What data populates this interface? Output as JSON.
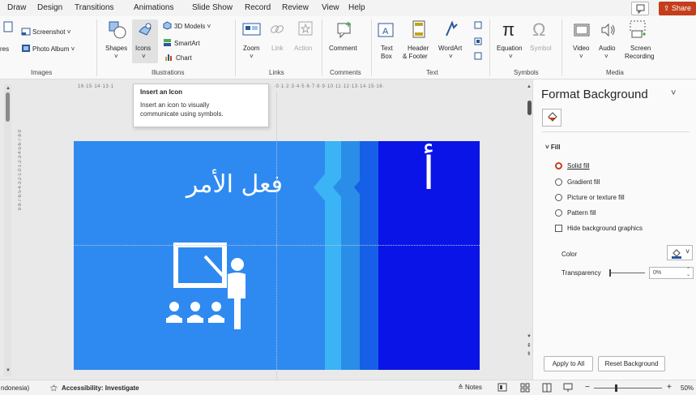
{
  "menu": {
    "tabs": [
      "Draw",
      "Design",
      "Transitions",
      "Animations",
      "Slide Show",
      "Record",
      "Review",
      "View",
      "Help"
    ],
    "share_label": "Share"
  },
  "ribbon": {
    "images": {
      "screenshot": "Screenshot ˅",
      "photo_album": "Photo Album ˅",
      "pictures_partial": "res",
      "group_label": "Images"
    },
    "illustrations": {
      "shapes": "Shapes",
      "icons": "Icons",
      "models_3d": "3D Models ˅",
      "smartart": "SmartArt",
      "chart": "Chart",
      "group_label": "Illustrations"
    },
    "links": {
      "zoom": "Zoom",
      "link": "Link",
      "action": "Action",
      "group_label": "Links"
    },
    "comments": {
      "comment": "Comment",
      "group_label": "Comments"
    },
    "text": {
      "text_box_1": "Text",
      "text_box_2": "Box",
      "header_footer_1": "Header",
      "header_footer_2": "& Footer",
      "wordart": "WordArt",
      "group_label": "Text"
    },
    "symbols": {
      "equation": "Equation",
      "symbol": "Symbol",
      "group_label": "Symbols"
    },
    "media": {
      "video": "Video",
      "audio": "Audio",
      "screen_rec_1": "Screen",
      "screen_rec_2": "Recording",
      "group_label": "Media"
    }
  },
  "tooltip": {
    "title": "Insert an Icon",
    "body_line1": "Insert an icon to visually",
    "body_line2": "communicate using symbols."
  },
  "ruler": {
    "horizontal": "16·15·14·13·1",
    "horizontal_right": "·0·1·2·3·4·5·6·7·8·9·10·11·12·13·14·15·16·",
    "vertical": "9·8·7·6·5·4·3·2·1·0·1·2·3·4·5·6·7·8·9"
  },
  "slide": {
    "title_text": "فعل الأمر",
    "letter": "أ",
    "colors": {
      "bg": "#2e8af0",
      "stripe1": "#3ab4f5",
      "stripe2": "#2a8ee8",
      "stripe3": "#1560e6",
      "right_block": "#0a14e6"
    }
  },
  "panel": {
    "title": "Format Background",
    "section_fill": "Fill",
    "options": [
      "Solid fill",
      "Gradient fill",
      "Picture or texture fill",
      "Pattern fill"
    ],
    "hide_bg_graphics": "Hide background graphics",
    "color_label": "Color",
    "transparency_label": "Transparency",
    "transparency_value": "0%",
    "apply_all": "Apply to All",
    "reset_bg": "Reset Background"
  },
  "status": {
    "language": "ndonesia)",
    "accessibility": "Accessibility: Investigate",
    "notes": "Notes",
    "zoom": "50%"
  }
}
